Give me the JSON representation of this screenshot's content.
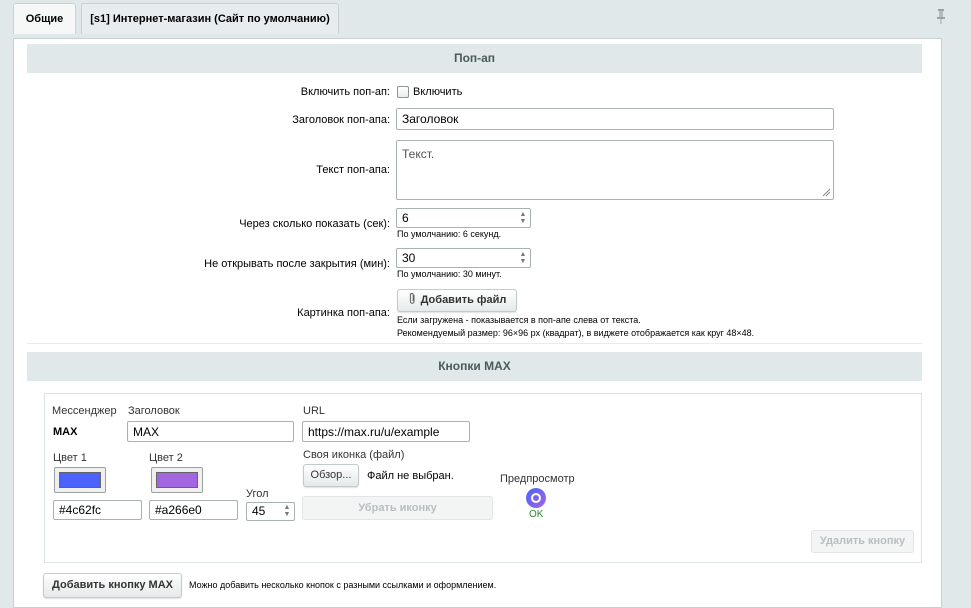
{
  "tabs": [
    {
      "label": "Общие"
    },
    {
      "label": "[s1] Интернет-магазин (Сайт по умолчанию)"
    }
  ],
  "popup": {
    "section_title": "Поп-ап",
    "enable_label": "Включить поп-ап:",
    "enable_checkbox_label": "Включить",
    "enable_checked": false,
    "title_label": "Заголовок поп-апа:",
    "title_value": "Заголовок",
    "text_label": "Текст поп-апа:",
    "text_value": "Текст.",
    "delay_label": "Через сколько показать (сек):",
    "delay_value": "6",
    "delay_hint": "По умолчанию: 6 секунд.",
    "noopen_label": "Не открывать после закрытия (мин):",
    "noopen_value": "30",
    "noopen_hint": "По умолчанию: 30 минут.",
    "image_label": "Картинка поп-апа:",
    "add_file_label": "Добавить файл",
    "image_hint_1": "Если загружена - показывается в поп-апе слева от текста.",
    "image_hint_2": "Рекомендуемый размер: 96×96 px (квадрат), в виджете отображается как круг 48×48."
  },
  "max_buttons": {
    "section_title": "Кнопки MAX",
    "messenger_label": "Мессенджер",
    "messenger_value": "MAX",
    "title_label": "Заголовок",
    "title_value": "MAX",
    "url_label": "URL",
    "url_value": "https://max.ru/u/example",
    "color1_label": "Цвет 1",
    "color1_value": "#4c62fc",
    "color2_label": "Цвет 2",
    "color2_value": "#a266e0",
    "angle_label": "Угол",
    "angle_value": "45",
    "icon_label": "Своя иконка (файл)",
    "browse_label": "Обзор...",
    "no_file_label": "Файл не выбран.",
    "remove_icon_label": "Убрать иконку",
    "preview_label": "Предпросмотр",
    "preview_caption": "OK",
    "delete_button_label": "Удалить кнопку",
    "add_button_label": "Добавить кнопку MAX",
    "add_hint": "Можно добавить несколько кнопок с разными ссылками и оформлением."
  }
}
